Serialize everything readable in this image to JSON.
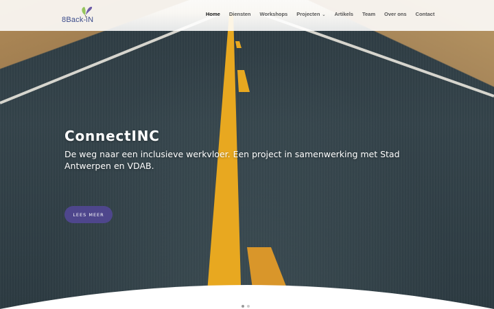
{
  "brand": {
    "logo_text": "8Back-iN"
  },
  "nav": {
    "items": [
      {
        "label": "Home",
        "active": true
      },
      {
        "label": "Diensten"
      },
      {
        "label": "Workshops"
      },
      {
        "label": "Projecten",
        "has_dropdown": true
      },
      {
        "label": "Artikels"
      },
      {
        "label": "Team"
      },
      {
        "label": "Over ons"
      },
      {
        "label": "Contact"
      }
    ]
  },
  "hero": {
    "title": "ConnectINC",
    "subtitle": "De weg naar een inclusieve werkvloer. Een project in samenwerking met Stad Antwerpen en VDAB.",
    "button_label": "LEES MEER",
    "slide_count": 2,
    "active_slide": 1
  },
  "colors": {
    "button": "#4e468c",
    "logo": "#3a4a8a",
    "road_line": "#f0b429"
  },
  "icons": {
    "logo": "butterfly-icon",
    "dropdown": "chevron-down-icon"
  }
}
